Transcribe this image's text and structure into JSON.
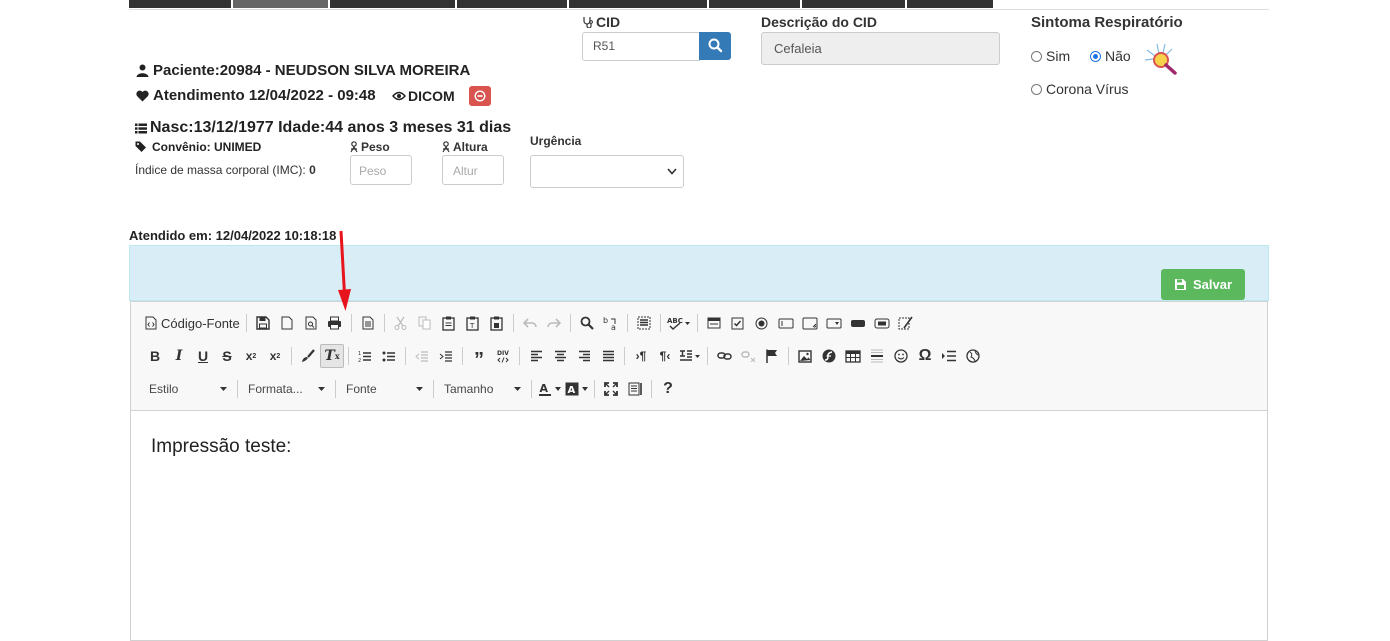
{
  "cid": {
    "label": "CID",
    "value": "R51"
  },
  "cid_desc": {
    "label": "Descrição do CID",
    "value": "Cefaleia"
  },
  "sintoma": {
    "label": "Sintoma Respiratório",
    "opt_sim": "Sim",
    "opt_nao": "Não",
    "opt_corona": "Corona Vírus",
    "selected": "Não"
  },
  "patient": {
    "paciente": "Paciente:20984 - NEUDSON SILVA MOREIRA",
    "atendimento": "Atendimento 12/04/2022 - 09:48",
    "dicom": "DICOM",
    "nasc": "Nasc:13/12/1977 Idade:44 anos 3 meses 31 dias",
    "convenio": "Convênio: UNIMED",
    "imc_label": "Índice de massa corporal (IMC):",
    "imc_value": "0"
  },
  "peso": {
    "label": "Peso",
    "placeholder": "Peso"
  },
  "altura": {
    "label": "Altura",
    "placeholder": "Altur"
  },
  "urgencia": {
    "label": "Urgência"
  },
  "atendido": "Atendido em: 12/04/2022 10:18:18",
  "save_label": "Salvar",
  "editor": {
    "source_label": "Código-Fonte",
    "combo_estilo": "Estilo",
    "combo_formato": "Formata...",
    "combo_fonte": "Fonte",
    "combo_tamanho": "Tamanho",
    "content": "Impressão teste:"
  },
  "colors": {
    "primary": "#337ab7",
    "success": "#5cb85c",
    "danger": "#d9534f",
    "panel": "#d9edf7",
    "arrow": "#e8141b"
  }
}
